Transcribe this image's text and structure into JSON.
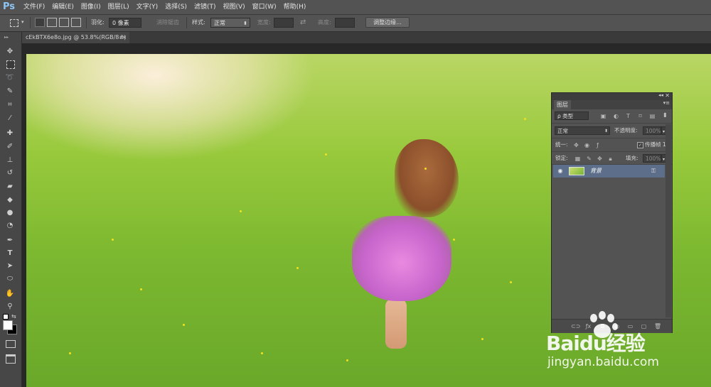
{
  "app": {
    "logo": "Ps"
  },
  "menu": [
    "文件(F)",
    "编辑(E)",
    "图像(I)",
    "图层(L)",
    "文字(Y)",
    "选择(S)",
    "滤镜(T)",
    "视图(V)",
    "窗口(W)",
    "帮助(H)"
  ],
  "options": {
    "feather_label": "羽化:",
    "feather_value": "0 像素",
    "antialias_label": "消除锯齿",
    "style_label": "样式:",
    "style_value": "正常",
    "width_label": "宽度:",
    "height_label": "高度:",
    "refine_edge_button": "调整边缘..."
  },
  "document": {
    "tab_title": "cEkBTX6e8o.jpg @ 53.8%(RGB/8#)",
    "close": "×"
  },
  "layers_panel": {
    "tab": "图层",
    "filter_label": "ρ 类型",
    "blend_mode": "正常",
    "opacity_label": "不透明度:",
    "opacity_value": "100%",
    "unify_label": "统一:",
    "propagate_label": "传播帧 1",
    "lock_label": "锁定:",
    "fill_label": "填充:",
    "fill_value": "100%",
    "layer": {
      "name": "背景"
    }
  },
  "watermark": {
    "brand": "Baidu经验",
    "url": "jingyan.baidu.com"
  }
}
